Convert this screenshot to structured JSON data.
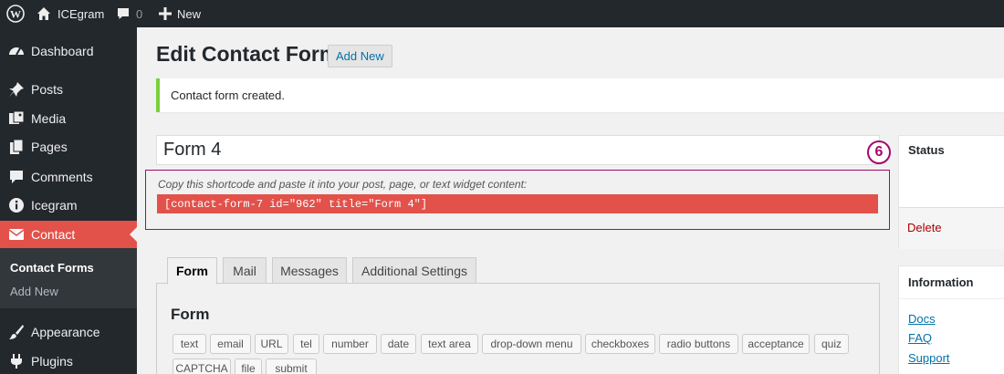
{
  "adminbar": {
    "site_name": "ICEgram",
    "comments_count": "0",
    "new_label": "New"
  },
  "sidebar": {
    "items": [
      {
        "label": "Dashboard",
        "icon": "dashboard-icon"
      },
      {
        "label": "Posts",
        "icon": "pin-icon"
      },
      {
        "label": "Media",
        "icon": "media-icon"
      },
      {
        "label": "Pages",
        "icon": "pages-icon"
      },
      {
        "label": "Comments",
        "icon": "comment-icon"
      },
      {
        "label": "Icegram",
        "icon": "info-icon"
      },
      {
        "label": "Contact",
        "icon": "envelope-icon"
      },
      {
        "label": "Appearance",
        "icon": "brush-icon"
      },
      {
        "label": "Plugins",
        "icon": "plug-icon"
      }
    ],
    "submenu": [
      "Contact Forms",
      "Add New"
    ]
  },
  "main": {
    "title": "Edit Contact Form",
    "add_new": "Add New",
    "notice": "Contact form created.",
    "form_title": "Form 4",
    "shortcode_hint": "Copy this shortcode and paste it into your post, page, or text widget content:",
    "shortcode": "[contact-form-7 id=\"962\" title=\"Form 4\"]",
    "step_badge": "6",
    "tabs": [
      "Form",
      "Mail",
      "Messages",
      "Additional Settings"
    ],
    "panel_title": "Form",
    "tags": [
      "text",
      "email",
      "URL",
      "tel",
      "number",
      "date",
      "text area",
      "drop-down menu",
      "checkboxes",
      "radio buttons",
      "acceptance",
      "quiz",
      "CAPTCHA",
      "file",
      "submit"
    ]
  },
  "status_box": {
    "title": "Status",
    "delete": "Delete"
  },
  "info_box": {
    "title": "Information",
    "links": [
      "Docs",
      "FAQ",
      "Support"
    ]
  },
  "colors": {
    "accent": "#e2524a",
    "annotation": "#a4086d",
    "link": "#0073aa"
  }
}
